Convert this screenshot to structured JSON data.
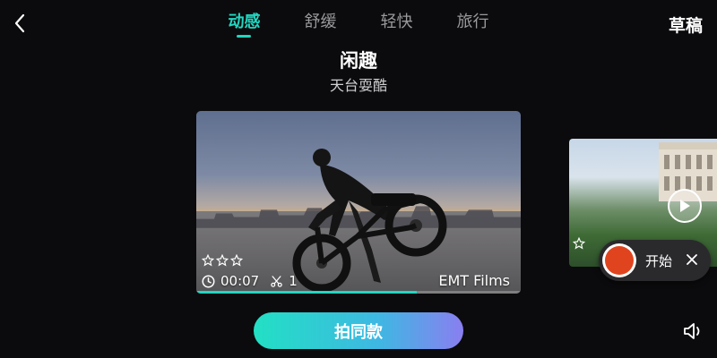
{
  "header": {
    "tabs": [
      {
        "label": "动感",
        "active": true
      },
      {
        "label": "舒缓",
        "active": false
      },
      {
        "label": "轻快",
        "active": false
      },
      {
        "label": "旅行",
        "active": false
      }
    ],
    "drafts_label": "草稿"
  },
  "template": {
    "title": "闲趣",
    "subtitle": "天台耍酷"
  },
  "card": {
    "rating": 0,
    "rating_max": 3,
    "duration": "00:07",
    "clip_count": "1",
    "credit": "EMT Films",
    "progress": 0.68
  },
  "recording": {
    "start_label": "开始"
  },
  "cta": {
    "label": "拍同款"
  },
  "colors": {
    "accent": "#22d6c0",
    "record": "#e0441e"
  }
}
